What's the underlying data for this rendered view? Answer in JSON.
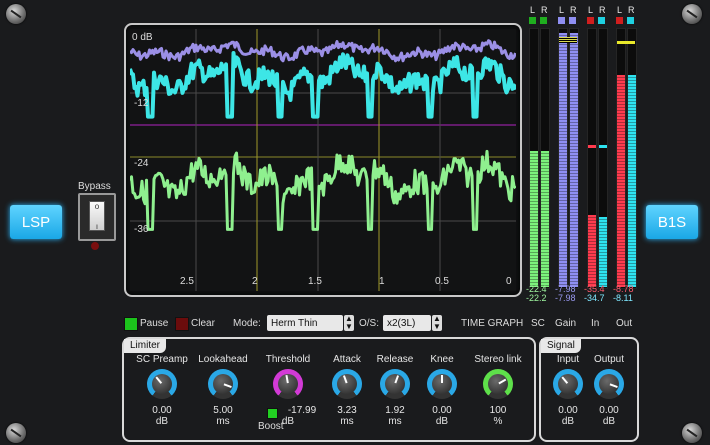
{
  "brand_left": "LSP",
  "brand_right": "B1S",
  "bypass": {
    "label": "Bypass"
  },
  "graph": {
    "top_label": "0 dB",
    "y_labels": [
      "-12",
      "-24",
      "-36"
    ],
    "x_labels": [
      "2.5",
      "2",
      "1.5",
      "1",
      "0.5",
      "0"
    ]
  },
  "meters": {
    "sc": {
      "l": "L",
      "r": "R",
      "val_top": "-22.4",
      "val_bottom": "-22.2"
    },
    "gain": {
      "l": "L",
      "r": "R",
      "val_top": "-7.98",
      "val_bottom": "-7.98"
    },
    "in": {
      "l": "L",
      "r": "R",
      "val_top": "-35.4",
      "val_bottom": "-34.7"
    },
    "out": {
      "l": "L",
      "r": "R",
      "val_top": "-8.78",
      "val_bottom": "-8.11"
    }
  },
  "controls": {
    "pause": "Pause",
    "clear": "Clear",
    "mode_label": "Mode:",
    "mode_value": "Herm Thin",
    "os_label": "O/S:",
    "os_value": "x2(3L)",
    "time_graph": "TIME GRAPH",
    "sc": "SC",
    "gain": "Gain",
    "in": "In",
    "out": "Out"
  },
  "limiter": {
    "title": "Limiter",
    "knobs": [
      {
        "label": "SC Preamp",
        "value": "0.00",
        "unit": "dB",
        "color": "#2aa8e6"
      },
      {
        "label": "Lookahead",
        "value": "5.00",
        "unit": "ms",
        "color": "#2aa8e6"
      },
      {
        "label": "Threshold",
        "value": "-17.99",
        "unit": "dB",
        "color": "#d23ad6"
      },
      {
        "label": "Attack",
        "value": "3.23",
        "unit": "ms",
        "color": "#2aa8e6"
      },
      {
        "label": "Release",
        "value": "1.92",
        "unit": "ms",
        "color": "#2aa8e6"
      },
      {
        "label": "Knee",
        "value": "0.00",
        "unit": "dB",
        "color": "#2aa8e6"
      },
      {
        "label": "Stereo link",
        "value": "100",
        "unit": "%",
        "color": "#5ee04a"
      }
    ],
    "boost": "Boost"
  },
  "signal": {
    "title": "Signal",
    "knobs": [
      {
        "label": "Input",
        "value": "0.00",
        "unit": "dB",
        "color": "#2aa8e6"
      },
      {
        "label": "Output",
        "value": "0.00",
        "unit": "dB",
        "color": "#2aa8e6"
      }
    ]
  }
}
